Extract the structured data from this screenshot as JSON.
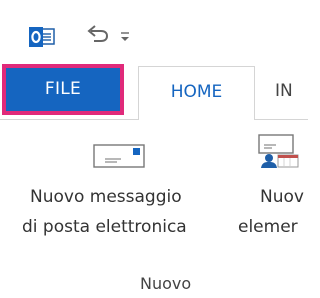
{
  "quick_access": {
    "logo_icon": "outlook-logo-icon",
    "undo_icon": "undo-icon",
    "dropdown_icon": "customize-toolbar-icon"
  },
  "tabs": {
    "file_label": "FILE",
    "home_label": "HOME",
    "next_label": "IN"
  },
  "ribbon": {
    "new_email_line1": "Nuovo messaggio",
    "new_email_line2": "di posta elettronica",
    "new_items_line1": "Nuov",
    "new_items_line2": "elemer",
    "group_label": "Nuovo"
  },
  "colors": {
    "file_tab_bg": "#1565c0",
    "file_tab_outline": "#e02a7a",
    "home_tab_text": "#1565c0"
  }
}
